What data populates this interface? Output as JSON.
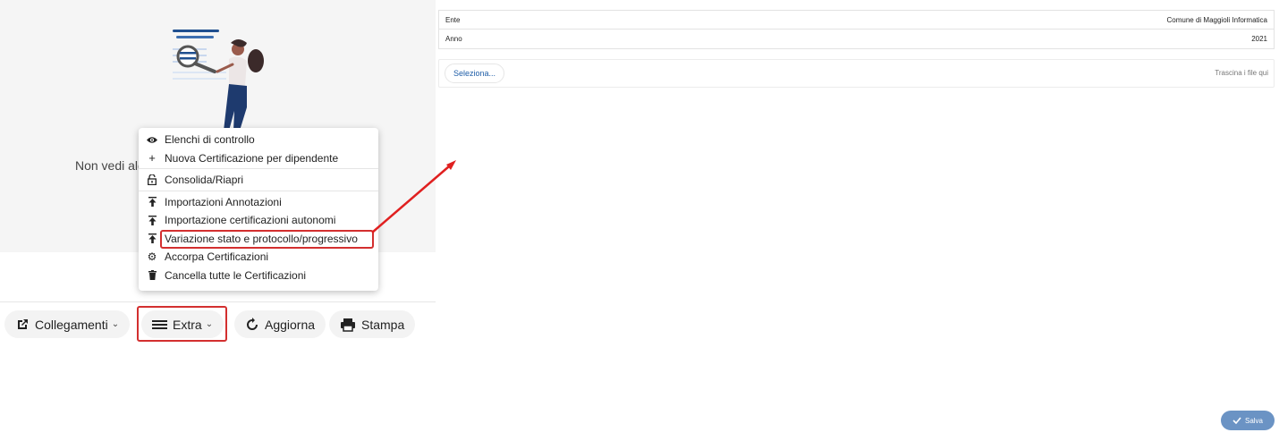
{
  "empty_state": {
    "message": "Non vedi alcun risultato? Modifica i criteri di ricerca."
  },
  "toolbar": {
    "links_label": "Collegamenti",
    "extra_label": "Extra",
    "refresh_label": "Aggiorna",
    "print_label": "Stampa"
  },
  "extra_menu": {
    "items": [
      {
        "label": "Elenchi di controllo",
        "icon": "eye-icon"
      },
      {
        "label": "Nuova Certificazione per dipendente",
        "icon": "plus-icon"
      },
      {
        "label": "Consolida/Riapri",
        "icon": "lock-open-icon"
      },
      {
        "label": "Importazioni Annotazioni",
        "icon": "upload-icon"
      },
      {
        "label": "Importazione certificazioni autonomi",
        "icon": "upload-icon"
      },
      {
        "label": "Variazione stato e protocollo/progressivo",
        "icon": "upload-icon"
      },
      {
        "label": "Accorpa Certificazioni",
        "icon": "gear-icon"
      },
      {
        "label": "Cancella tutte le Certificazioni",
        "icon": "trash-icon"
      }
    ]
  },
  "form": {
    "ente_label": "Ente",
    "ente_value": "Comune di Maggioli Informatica",
    "anno_label": "Anno",
    "anno_value": "2021",
    "select_label": "Seleziona...",
    "drop_hint": "Trascina i file qui",
    "save_label": "Salva"
  },
  "colors": {
    "highlight": "#d32f2f",
    "save_button": "#6b93c4",
    "link": "#1f5ea8"
  }
}
